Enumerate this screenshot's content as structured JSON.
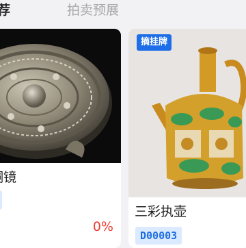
{
  "tabs": {
    "active": "荐",
    "inactive": "拍卖预展"
  },
  "cards": [
    {
      "title": "铜镜",
      "progress": "0%",
      "progress_color": "#ee3b30"
    },
    {
      "tag": "摘挂牌",
      "title": "三彩执壶",
      "lot": "D00003"
    }
  ],
  "colors": {
    "accent": "#1d6ee8",
    "badge_bg": "#dbeafe",
    "badge_text": "#1e6fe0"
  }
}
